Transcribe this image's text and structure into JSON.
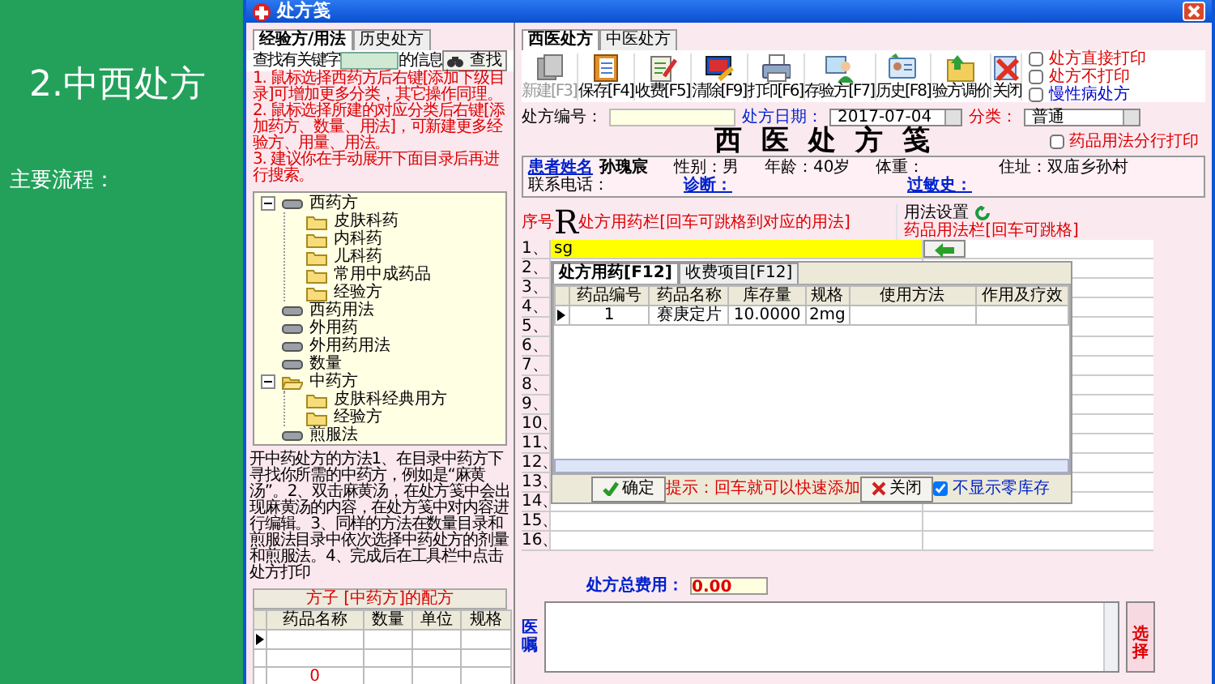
{
  "slide": {
    "title": "2.中西处方",
    "subtitle": "主要流程："
  },
  "window": {
    "title": "处方笺"
  },
  "left_panel": {
    "tabs": [
      {
        "label": "经验方/用法",
        "selected": true
      },
      {
        "label": "历史处方",
        "selected": false
      }
    ],
    "search": {
      "label": "查找有关键字",
      "suffix": "的信息",
      "button": "查找"
    },
    "instructions": [
      "1. 鼠标选择西药方后右键[添加下级目录]可增加更多分类，其它操作同理。",
      "2. 鼠标选择所建的对应分类后右键[添加药方、数量、用法]，可新建更多经验方、用量、用法。",
      "3. 建议你在手动展开下面目录后再进行搜索。"
    ],
    "tree": [
      {
        "label": "西药方",
        "kind": "drive",
        "expanded": true,
        "children": [
          {
            "label": "皮肤科药",
            "kind": "folder"
          },
          {
            "label": "内科药",
            "kind": "folder"
          },
          {
            "label": "儿科药",
            "kind": "folder"
          },
          {
            "label": "常用中成药品",
            "kind": "folder"
          },
          {
            "label": "经验方",
            "kind": "folder"
          }
        ]
      },
      {
        "label": "西药用法",
        "kind": "drive"
      },
      {
        "label": "外用药",
        "kind": "drive"
      },
      {
        "label": "外用药用法",
        "kind": "drive"
      },
      {
        "label": "数量",
        "kind": "drive"
      },
      {
        "label": "中药方",
        "kind": "open-folder",
        "expanded": true,
        "children": [
          {
            "label": "皮肤科经典用方",
            "kind": "folder"
          },
          {
            "label": "经验方",
            "kind": "folder"
          }
        ]
      },
      {
        "label": "煎服法",
        "kind": "drive"
      }
    ],
    "help_text": "开中药处方的方法1、在目录中药方下寻找你所需的中药方，例如是“麻黄汤”。2、双击麻黄汤，在处方笺中会出现麻黄汤的内容，在处方笺中对内容进行编辑。3、同样的方法在数量目录和煎服法目录中依次选择中药处方的剂量和煎服法。4、完成后在工具栏中点击处方打印",
    "formula": {
      "title": "方子 [中药方]的配方",
      "columns": [
        "药品名称",
        "数量",
        "单位",
        "规格"
      ],
      "total": "0"
    }
  },
  "right_panel": {
    "tabs": [
      {
        "label": "西医处方",
        "selected": true
      },
      {
        "label": "中医处方",
        "selected": false
      }
    ],
    "toolbar": [
      {
        "label": "新建[F3]",
        "kind": "new",
        "disabled": true
      },
      {
        "label": "保存[F4]",
        "kind": "save",
        "disabled": false
      },
      {
        "label": "收费[F5]",
        "kind": "charge",
        "disabled": false
      },
      {
        "label": "清除[F9]",
        "kind": "clear",
        "disabled": false
      },
      {
        "label": "打印[F6]",
        "kind": "print",
        "disabled": false
      },
      {
        "label": "存验方[F7]",
        "kind": "store",
        "disabled": false
      },
      {
        "label": "历史[F8]",
        "kind": "history",
        "disabled": false
      },
      {
        "label": "验方调价",
        "kind": "price",
        "disabled": false
      },
      {
        "label": "关闭",
        "kind": "close",
        "disabled": false
      }
    ],
    "options": [
      {
        "label": "处方直接打印",
        "checked": false,
        "color": "#dd0000"
      },
      {
        "label": "处方不打印",
        "checked": false,
        "color": "#dd0000"
      },
      {
        "label": "慢性病处方",
        "checked": false,
        "color": "#0000cc"
      }
    ],
    "form": {
      "number_label": "处方编号：",
      "date_label": "处方日期：",
      "date": "2017-07-04",
      "category_label": "分类：",
      "category": "普通"
    },
    "title": "西 医 处 方 笺",
    "split_print": {
      "label": "药品用法分行打印",
      "checked": false
    },
    "patient": {
      "name_label": "患者姓名",
      "name": "孙瑰宸",
      "sex": "性别：男",
      "age": "年龄：40岁",
      "weight": "体重：",
      "address": "住址：双庙乡孙村",
      "phone": "联系电话：",
      "diagnosis": "诊断：",
      "allergy": "过敏史："
    },
    "rx_header": {
      "index_label": "序号",
      "symbol": "R",
      "drug_hint": "处方用药栏[回车可跳格到对应的用法]",
      "usage_settings": "用法设置",
      "usage_hint": "药品用法栏[回车可跳格]"
    },
    "rows": [
      {
        "number": "1、",
        "drug": "sg"
      },
      {
        "number": "2、"
      },
      {
        "number": "3、"
      },
      {
        "number": "4、"
      },
      {
        "number": "5、"
      },
      {
        "number": "6、"
      },
      {
        "number": "7、"
      },
      {
        "number": "8、"
      },
      {
        "number": "9、"
      },
      {
        "number": "10、"
      },
      {
        "number": "11、"
      },
      {
        "number": "12、"
      },
      {
        "number": "13、"
      },
      {
        "number": "14、"
      },
      {
        "number": "15、"
      },
      {
        "number": "16、"
      }
    ],
    "popup": {
      "tabs": [
        {
          "label": "处方用药[F12]",
          "selected": true
        },
        {
          "label": "收费项目[F12]",
          "selected": false
        }
      ],
      "columns": [
        "药品编号",
        "药品名称",
        "库存量",
        "规格",
        "使用方法",
        "作用及疗效"
      ],
      "rows": [
        [
          "1",
          "赛庚定片",
          "10.0000",
          "2mg",
          "",
          ""
        ]
      ],
      "ok": "确定",
      "hint": "提示：回车就可以快速添加",
      "close": "关闭",
      "hide_zero": {
        "label": "不显示零库存",
        "checked": true
      }
    },
    "total": {
      "label": "处方总费用：",
      "value": "0.00"
    },
    "advice": {
      "label": "医嘱",
      "button": "选择"
    }
  }
}
